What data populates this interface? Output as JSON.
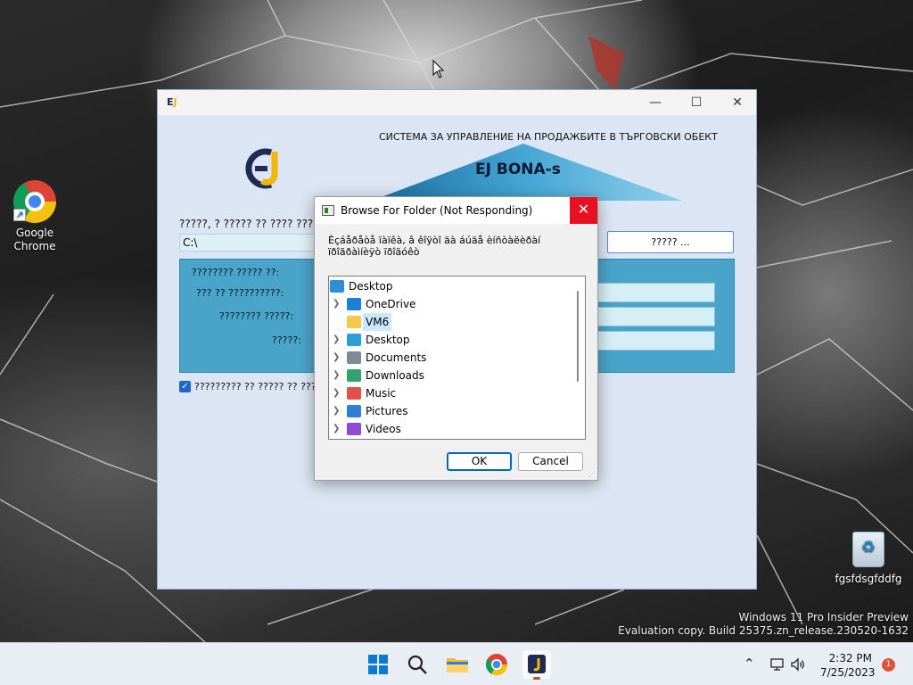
{
  "desktop": {
    "icons": [
      {
        "name": "chrome",
        "label": "Google Chrome"
      },
      {
        "name": "recycle-bin",
        "label": "fgsfdsgfddfg"
      }
    ],
    "watermark_line1": "Windows 11 Pro Insider Preview",
    "watermark_line2": "Evaluation copy. Build 25375.zn_release.230520-1632"
  },
  "app": {
    "title_icon": "EJ",
    "heading": "СИСТЕМА ЗА УПРАВЛЕНИЕ НА ПРОДАЖБИТЕ В ТЪРГОВСКИ ОБЕКТ",
    "brand": "EJ BONA-s",
    "folder_label": "?????, ? ????? ?? ???? ?????",
    "path_value": "C:\\",
    "browse_label": "????? ...",
    "panel": {
      "header": "???????? ????? ??:",
      "rows": [
        {
          "label": "??? ?? ??????????:"
        },
        {
          "label": "???????? ?????:"
        },
        {
          "label": "?????:"
        }
      ]
    },
    "checkbox_label": "????????? ?? ????? ?? ???????",
    "checkbox_checked": true
  },
  "dialog": {
    "title": "Browse For Folder (Not Responding)",
    "close_glyph": "✕",
    "description": "Èçáåðåòå ïàïêà, â êîÿòî äà áúäå èíñòàëèðàí ïðîãðàìíèÿò ïðîäóêò",
    "tree": [
      {
        "name": "desktop-root",
        "label": "Desktop",
        "level": 0,
        "chevron": false,
        "icon": "desktop-icon",
        "color": "#2b8fd6"
      },
      {
        "name": "onedrive",
        "label": "OneDrive",
        "level": 1,
        "chevron": true,
        "icon": "cloud-icon",
        "color": "#1c7fd6"
      },
      {
        "name": "vm6",
        "label": "VM6",
        "level": 1,
        "chevron": false,
        "icon": "folder-icon",
        "color": "#f7c948",
        "selected": true
      },
      {
        "name": "desktop",
        "label": "Desktop",
        "level": 1,
        "chevron": true,
        "icon": "desktop-icon",
        "color": "#2b9fd6"
      },
      {
        "name": "documents",
        "label": "Documents",
        "level": 1,
        "chevron": true,
        "icon": "document-icon",
        "color": "#7d8b99"
      },
      {
        "name": "downloads",
        "label": "Downloads",
        "level": 1,
        "chevron": true,
        "icon": "download-icon",
        "color": "#2fa36b"
      },
      {
        "name": "music",
        "label": "Music",
        "level": 1,
        "chevron": true,
        "icon": "music-icon",
        "color": "#e0524a"
      },
      {
        "name": "pictures",
        "label": "Pictures",
        "level": 1,
        "chevron": true,
        "icon": "pictures-icon",
        "color": "#2f7fd6"
      },
      {
        "name": "videos",
        "label": "Videos",
        "level": 1,
        "chevron": true,
        "icon": "video-icon",
        "color": "#8e4ad6"
      }
    ],
    "ok_label": "OK",
    "cancel_label": "Cancel"
  },
  "taskbar": {
    "time": "2:32 PM",
    "date": "7/25/2023",
    "notification_count": "1"
  },
  "colors": {
    "accent": "#0067c0",
    "close_red": "#e81123",
    "panel_blue": "#4aa3c9",
    "app_bg": "#dbe5f3"
  }
}
